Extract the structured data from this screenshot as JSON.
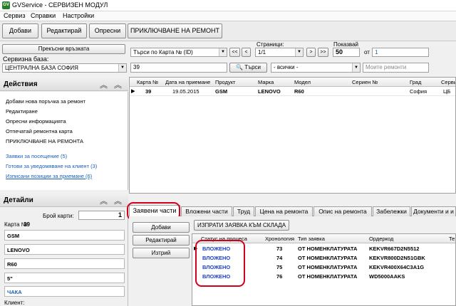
{
  "window": {
    "title": "GVService - СЕРВИЗЕН МОДУЛ"
  },
  "menu": [
    "Сервиз",
    "Справки",
    "Настройки"
  ],
  "toolbar": {
    "add": "Добави",
    "edit": "Редактирай",
    "refresh": "Опресни",
    "finish": "ПРИКЛЮЧВАНЕ НА РЕМОНТ"
  },
  "connection": {
    "disconnect": "Прекъсни връзката",
    "db_label": "Сервизна база:",
    "db_value": "ЦЕНТРАЛНА БАЗА СОФИЯ"
  },
  "search": {
    "by": "Търси по Карта № (ID)",
    "value": "39",
    "button": "Търси",
    "filter": "- всички -",
    "my_repairs": "Моите ремонти",
    "nav_first": "<<",
    "nav_prev": "<",
    "nav_next": ">",
    "nav_last": ">>"
  },
  "paging": {
    "pages_label": "Страници:",
    "pages_value": "1/1",
    "shown_label": "Показвай",
    "shown_value": "50",
    "from_label": "от",
    "from_value": "1"
  },
  "actions": {
    "title": "Действия",
    "items": [
      "Добави нова поръчка за ремонт",
      "Редактиране",
      "Опресни информацията",
      "Отпечатай ремонтна карта",
      "ПРИКЛЮЧВАНЕ НА РЕМОНТА"
    ],
    "links": [
      "Заявки за посещение (5)",
      "Готови за уведомяване на клиент (3)",
      "Изписани позиции за приемане (6)"
    ]
  },
  "details": {
    "title": "Детайли",
    "count_label": "Брой карти:",
    "count_value": "1",
    "card_label": "Карта №",
    "card_value": "39",
    "fields": [
      "GSM",
      "LENOVO",
      "R60",
      "5\"",
      "ЧАКА"
    ],
    "client_label": "Клиент:"
  },
  "grid": {
    "columns": [
      "Карта №",
      "Дата на приемане",
      "Продукт",
      "Марка",
      "Модел",
      "Сериен №",
      "Град",
      "Серви"
    ],
    "rows": [
      {
        "marker": "▶",
        "card": "39",
        "date": "19.05.2015",
        "product": "GSM",
        "brand": "LENOVO",
        "model": "R60",
        "serial": "",
        "city": "София",
        "service": "ЦБ"
      }
    ]
  },
  "tabs": [
    "Заявени части",
    "Вложени части",
    "Труд",
    "Цена на ремонта",
    "Опис на ремонта",
    "Забележки",
    "Документи и и"
  ],
  "parts": {
    "add": "Добави",
    "edit": "Редактирай",
    "delete": "Изтрий",
    "send_request": "ИЗПРАТИ ЗАЯВКА КЪМ СКЛАДА",
    "columns": [
      "Статус на процеса",
      "Хронология",
      "Тип заявка",
      "Ордеркод",
      "Те"
    ],
    "rows": [
      {
        "marker": "▶",
        "status": "ВЛОЖЕНО",
        "chron": "73",
        "type": "ОТ НОМЕНКЛАТУРАТА",
        "code": "KEKVR667D2N5512"
      },
      {
        "marker": "",
        "status": "ВЛОЖЕНО",
        "chron": "74",
        "type": "ОТ НОМЕНКЛАТУРАТА",
        "code": "KEKVR800D2N51GBK"
      },
      {
        "marker": "",
        "status": "ВЛОЖЕНО",
        "chron": "75",
        "type": "ОТ НОМЕНКЛАТУРАТА",
        "code": "KEKVR400X64C3A1G"
      },
      {
        "marker": "",
        "status": "ВЛОЖЕНО",
        "chron": "76",
        "type": "ОТ НОМЕНКЛАТУРАТА",
        "code": "WD5000AAKS"
      }
    ]
  },
  "colors": {
    "link": "#1a5fb4",
    "status": "#1a3fd0",
    "highlight": "#d0021b"
  },
  "icons": {
    "app": "app-logo-icon",
    "search": "magnifier-icon",
    "collapse": "double-chevron-up-icon"
  }
}
